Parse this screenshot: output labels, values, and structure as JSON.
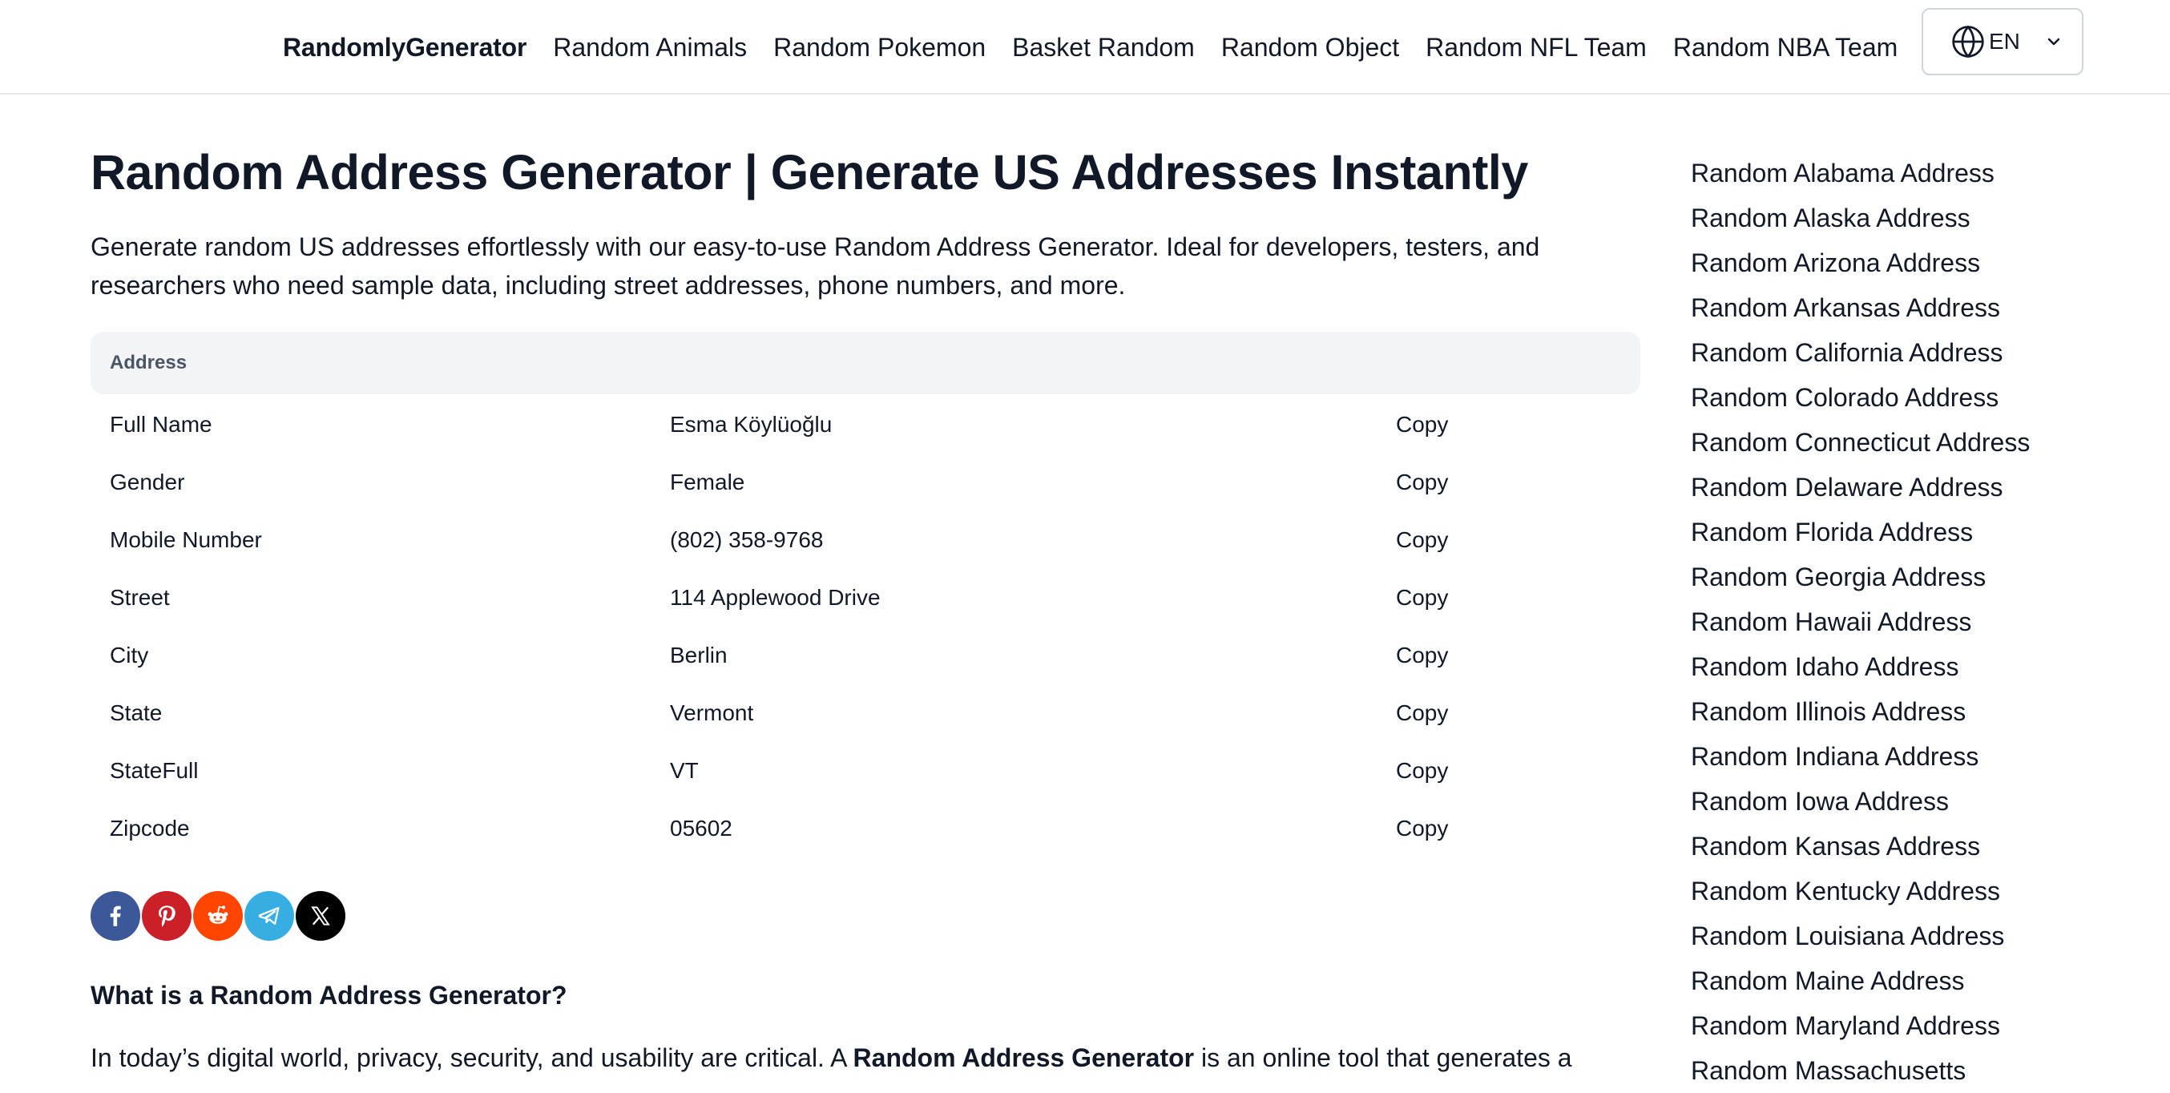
{
  "nav": {
    "brand": "RandomlyGenerator",
    "links": [
      "Random Animals",
      "Random Pokemon",
      "Basket Random",
      "Random Object",
      "Random NFL Team",
      "Random NBA Team"
    ],
    "language": "EN"
  },
  "main": {
    "title": "Random Address Generator | Generate US Addresses Instantly",
    "intro_line1": "Generate random US addresses effortlessly with our easy-to-use Random Address Generator. Ideal for developers, testers, and",
    "intro_line2": "researchers who need sample data, including street addresses, phone numbers, and more.",
    "table_header": "Address",
    "rows": [
      {
        "label": "Full Name",
        "value": "Esma Köylüoğlu",
        "action": "Copy"
      },
      {
        "label": "Gender",
        "value": "Female",
        "action": "Copy"
      },
      {
        "label": "Mobile Number",
        "value": "(802) 358-9768",
        "action": "Copy"
      },
      {
        "label": "Street",
        "value": "114 Applewood Drive",
        "action": "Copy"
      },
      {
        "label": "City",
        "value": "Berlin",
        "action": "Copy"
      },
      {
        "label": "State",
        "value": "Vermont",
        "action": "Copy"
      },
      {
        "label": "StateFull",
        "value": "VT",
        "action": "Copy"
      },
      {
        "label": "Zipcode",
        "value": "05602",
        "action": "Copy"
      }
    ],
    "share": [
      {
        "name": "facebook-icon",
        "color": "#3b5998"
      },
      {
        "name": "pinterest-icon",
        "color": "#cb2027"
      },
      {
        "name": "reddit-icon",
        "color": "#ff4500"
      },
      {
        "name": "telegram-icon",
        "color": "#37aee2"
      },
      {
        "name": "x-icon",
        "color": "#000000"
      }
    ],
    "section_heading": "What is a Random Address Generator?",
    "para_start": "In today’s digital world, privacy, security, and usability are critical. A ",
    "para_bold": "Random Address Generator",
    "para_end": " is an online tool that generates a"
  },
  "sidebar": {
    "links": [
      "Random Alabama Address",
      "Random Alaska Address",
      "Random Arizona Address",
      "Random Arkansas Address",
      "Random California Address",
      "Random Colorado Address",
      "Random Connecticut Address",
      "Random Delaware Address",
      "Random Florida Address",
      "Random Georgia Address",
      "Random Hawaii Address",
      "Random Idaho Address",
      "Random Illinois Address",
      "Random Indiana Address",
      "Random Iowa Address",
      "Random Kansas Address",
      "Random Kentucky Address",
      "Random Louisiana Address",
      "Random Maine Address",
      "Random Maryland Address",
      "Random Massachusetts"
    ]
  }
}
